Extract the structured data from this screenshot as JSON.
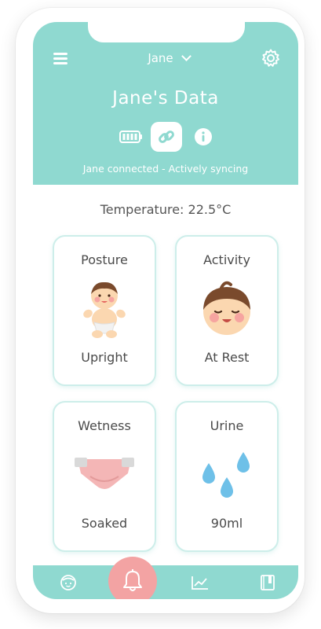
{
  "header": {
    "user_name": "Jane",
    "title": "Jane's Data",
    "status": "Jane connected - Actively syncing"
  },
  "temperature": "Temperature: 22.5°C",
  "cards": [
    {
      "label": "Posture",
      "value": "Upright",
      "icon": "baby-upright-icon"
    },
    {
      "label": "Activity",
      "value": "At Rest",
      "icon": "baby-face-icon"
    },
    {
      "label": "Wetness",
      "value": "Soaked",
      "icon": "diaper-icon"
    },
    {
      "label": "Urine",
      "value": "90ml",
      "icon": "water-drops-icon"
    }
  ],
  "nav": {
    "items": [
      "baby-profile-icon",
      "bell-icon",
      "chart-icon",
      "journal-icon"
    ]
  },
  "colors": {
    "primary": "#8fd9d0",
    "alert": "#f3a3a3",
    "card_border": "#cdeeea",
    "text": "#4a4a4a"
  }
}
